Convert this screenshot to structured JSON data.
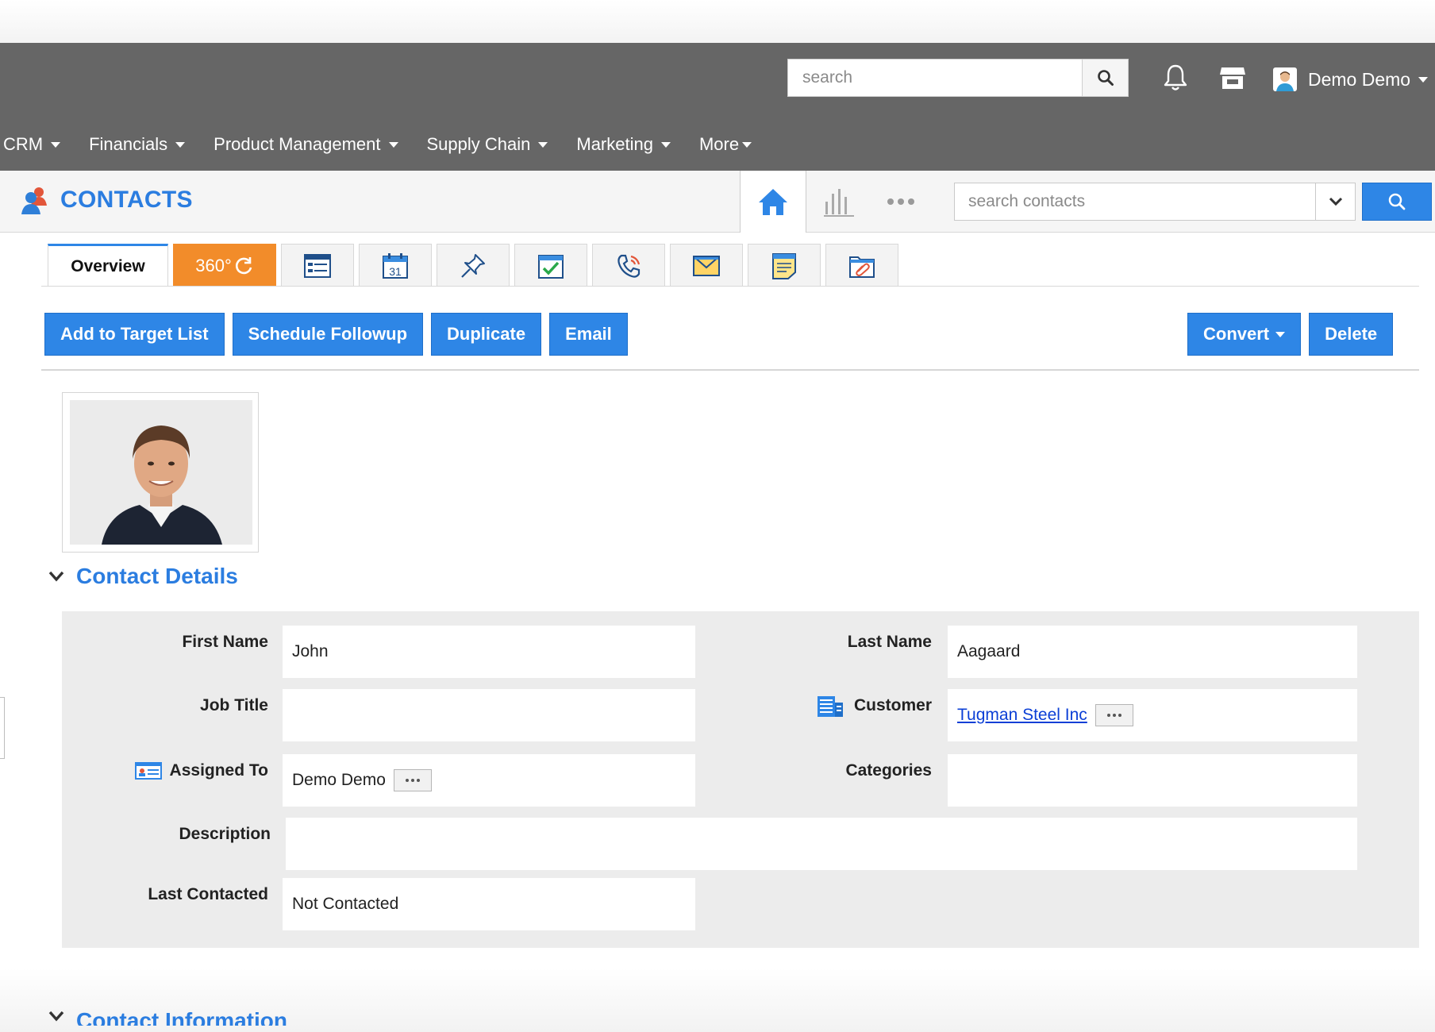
{
  "header": {
    "search_placeholder": "search",
    "user_name": "Demo Demo"
  },
  "nav": {
    "items": [
      {
        "label": "CRM"
      },
      {
        "label": "Financials"
      },
      {
        "label": "Product Management"
      },
      {
        "label": "Supply Chain"
      },
      {
        "label": "Marketing"
      },
      {
        "label": "More"
      }
    ]
  },
  "module": {
    "title": "CONTACTS",
    "search_placeholder": "search contacts"
  },
  "tabs": {
    "overview": "Overview",
    "t360": "360°"
  },
  "actions": {
    "add_target": "Add to Target List",
    "followup": "Schedule Followup",
    "duplicate": "Duplicate",
    "email": "Email",
    "convert": "Convert",
    "delete": "Delete"
  },
  "section": {
    "contact_details": "Contact Details",
    "contact_information": "Contact Information"
  },
  "fields": {
    "first_name_label": "First Name",
    "first_name": "John",
    "last_name_label": "Last Name",
    "last_name": "Aagaard",
    "job_title_label": "Job Title",
    "job_title": "",
    "customer_label": "Customer",
    "customer": "Tugman Steel Inc",
    "assigned_to_label": "Assigned To",
    "assigned_to": "Demo Demo",
    "categories_label": "Categories",
    "categories": "",
    "description_label": "Description",
    "description": "",
    "last_contacted_label": "Last Contacted",
    "last_contacted": "Not Contacted"
  },
  "colors": {
    "topbar": "#666666",
    "accent": "#2e86e6",
    "tab360": "#f28c2a",
    "title": "#2b7de0"
  }
}
